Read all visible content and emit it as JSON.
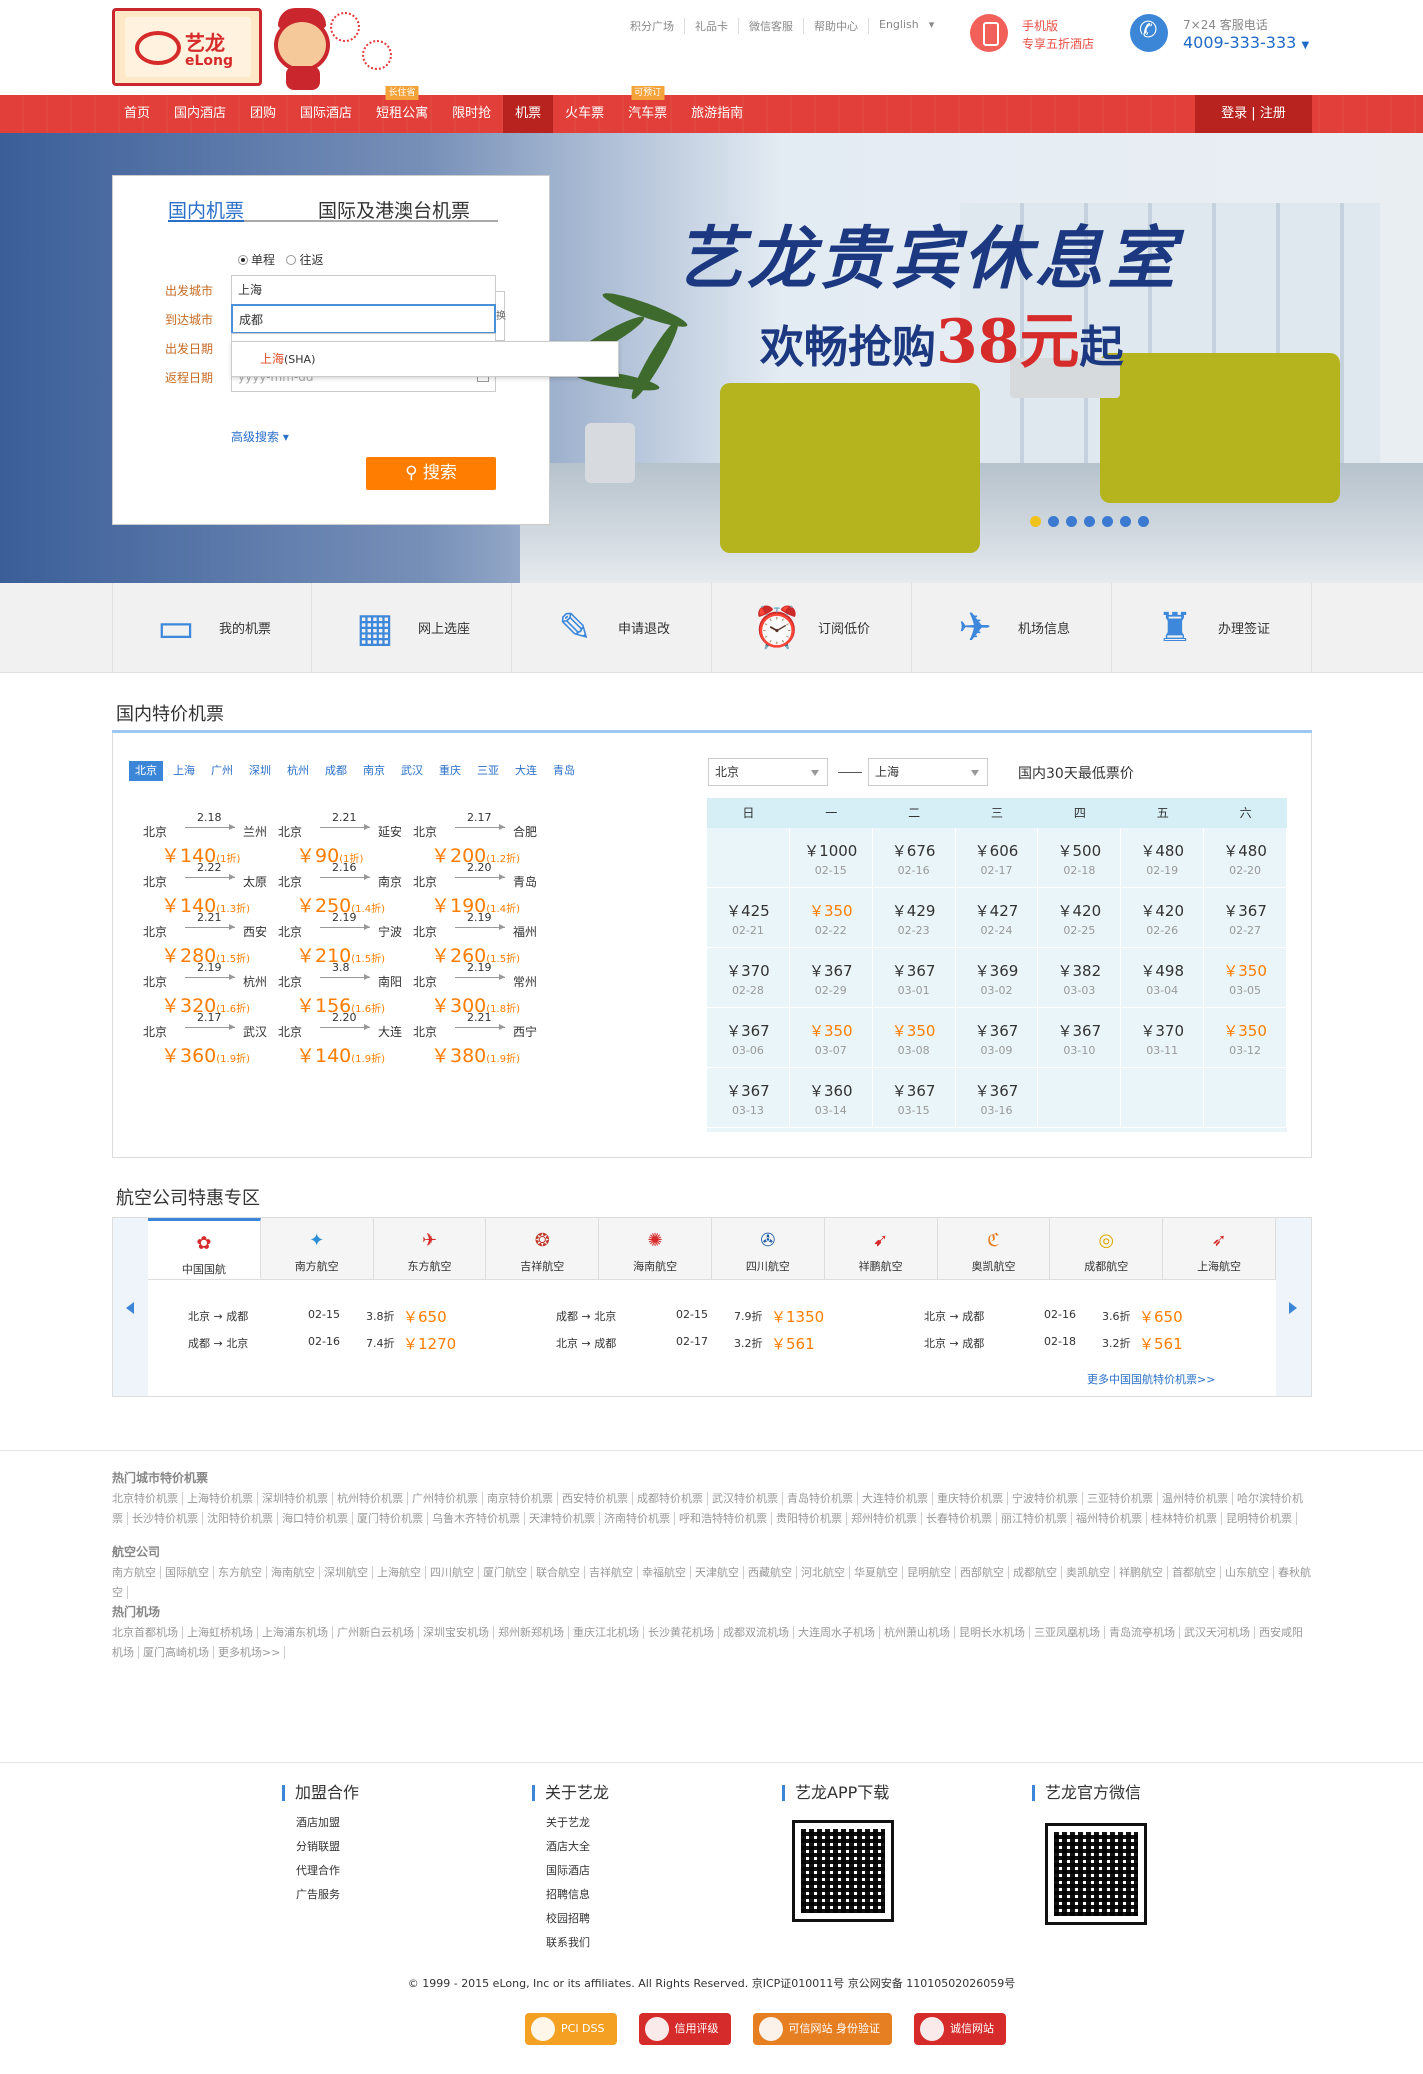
{
  "header": {
    "logo_cn": "艺龙",
    "logo_en": "eLong",
    "top_links": [
      "积分广场",
      "礼品卡",
      "微信客服",
      "帮助中心",
      "English"
    ],
    "mobile_title": "手机版",
    "mobile_sub": "专享五折酒店",
    "service_label": "7×24 客服电话",
    "service_phone": "4009-333-333"
  },
  "nav": {
    "items": [
      {
        "label": "首页",
        "badge": ""
      },
      {
        "label": "国内酒店",
        "badge": ""
      },
      {
        "label": "团购",
        "badge": ""
      },
      {
        "label": "国际酒店",
        "badge": ""
      },
      {
        "label": "短租公寓",
        "badge": "长住省"
      },
      {
        "label": "限时抢",
        "badge": ""
      },
      {
        "label": "机票",
        "badge": ""
      },
      {
        "label": "火车票",
        "badge": ""
      },
      {
        "label": "汽车票",
        "badge": "可预订"
      },
      {
        "label": "旅游指南",
        "badge": ""
      }
    ],
    "login": "登录 | 注册",
    "active_index": 6
  },
  "banner": {
    "title": "艺龙贵宾休息室",
    "sub_prefix": "欢畅抢购",
    "sub_price": "38元",
    "sub_suffix": "起",
    "slide_count": 7,
    "active_slide": 0
  },
  "search": {
    "tab_domestic": "国内机票",
    "tab_intl": "国际及港澳台机票",
    "one_way": "单程",
    "round_trip": "往返",
    "depart_label": "出发城市",
    "depart_value": "上海",
    "arrive_label": "到达城市",
    "arrive_value": "成都",
    "swap_label": "换",
    "date_label": "出发日期",
    "return_label": "返程日期",
    "return_placeholder": "yyyy-mm-dd",
    "suggestion_city": "上海",
    "suggestion_code": "(SHA)",
    "advanced": "高级搜索",
    "button": "搜索"
  },
  "quick_links": [
    {
      "label": "我的机票",
      "icon": "ticket-card-icon"
    },
    {
      "label": "网上选座",
      "icon": "seat-select-icon"
    },
    {
      "label": "申请退改",
      "icon": "edit-icon"
    },
    {
      "label": "订阅低价",
      "icon": "alarm-clock-icon"
    },
    {
      "label": "机场信息",
      "icon": "airplane-icon"
    },
    {
      "label": "办理签证",
      "icon": "stamp-icon"
    }
  ],
  "special": {
    "title": "国内特价机票",
    "cities": [
      "北京",
      "上海",
      "广州",
      "深圳",
      "杭州",
      "成都",
      "南京",
      "武汉",
      "重庆",
      "三亚",
      "大连",
      "青岛"
    ],
    "active_city": 0,
    "fares": [
      {
        "from": "北京",
        "to": "兰州",
        "date": "2.18",
        "price": "￥140",
        "disc": "(1折)"
      },
      {
        "from": "北京",
        "to": "延安",
        "date": "2.21",
        "price": "￥90",
        "disc": "(1折)"
      },
      {
        "from": "北京",
        "to": "合肥",
        "date": "2.17",
        "price": "￥200",
        "disc": "(1.2折)"
      },
      {
        "from": "北京",
        "to": "太原",
        "date": "2.22",
        "price": "￥140",
        "disc": "(1.3折)"
      },
      {
        "from": "北京",
        "to": "南京",
        "date": "2.16",
        "price": "￥250",
        "disc": "(1.4折)"
      },
      {
        "from": "北京",
        "to": "青岛",
        "date": "2.20",
        "price": "￥190",
        "disc": "(1.4折)"
      },
      {
        "from": "北京",
        "to": "西安",
        "date": "2.21",
        "price": "￥280",
        "disc": "(1.5折)"
      },
      {
        "from": "北京",
        "to": "宁波",
        "date": "2.19",
        "price": "￥210",
        "disc": "(1.5折)"
      },
      {
        "from": "北京",
        "to": "福州",
        "date": "2.19",
        "price": "￥260",
        "disc": "(1.5折)"
      },
      {
        "from": "北京",
        "to": "杭州",
        "date": "2.19",
        "price": "￥320",
        "disc": "(1.6折)"
      },
      {
        "from": "北京",
        "to": "南阳",
        "date": "3.8",
        "price": "￥156",
        "disc": "(1.6折)"
      },
      {
        "from": "北京",
        "to": "常州",
        "date": "2.19",
        "price": "￥300",
        "disc": "(1.8折)"
      },
      {
        "from": "北京",
        "to": "武汉",
        "date": "2.17",
        "price": "￥360",
        "disc": "(1.9折)"
      },
      {
        "from": "北京",
        "to": "大连",
        "date": "2.20",
        "price": "￥140",
        "disc": "(1.9折)"
      },
      {
        "from": "北京",
        "to": "西宁",
        "date": "2.21",
        "price": "￥380",
        "disc": "(1.9折)"
      }
    ],
    "from_select": "北京",
    "to_select": "上海",
    "calendar_label": "国内30天最低票价",
    "weekdays": [
      "日",
      "一",
      "二",
      "三",
      "四",
      "五",
      "六"
    ],
    "calendar": [
      {
        "col": 1,
        "row": 0,
        "price": "￥1000",
        "date": "02-15",
        "hi": false
      },
      {
        "col": 2,
        "row": 0,
        "price": "￥676",
        "date": "02-16",
        "hi": false
      },
      {
        "col": 3,
        "row": 0,
        "price": "￥606",
        "date": "02-17",
        "hi": false
      },
      {
        "col": 4,
        "row": 0,
        "price": "￥500",
        "date": "02-18",
        "hi": false
      },
      {
        "col": 5,
        "row": 0,
        "price": "￥480",
        "date": "02-19",
        "hi": false
      },
      {
        "col": 6,
        "row": 0,
        "price": "￥480",
        "date": "02-20",
        "hi": false
      },
      {
        "col": 0,
        "row": 1,
        "price": "￥425",
        "date": "02-21",
        "hi": false
      },
      {
        "col": 1,
        "row": 1,
        "price": "￥350",
        "date": "02-22",
        "hi": true
      },
      {
        "col": 2,
        "row": 1,
        "price": "￥429",
        "date": "02-23",
        "hi": false
      },
      {
        "col": 3,
        "row": 1,
        "price": "￥427",
        "date": "02-24",
        "hi": false
      },
      {
        "col": 4,
        "row": 1,
        "price": "￥420",
        "date": "02-25",
        "hi": false
      },
      {
        "col": 5,
        "row": 1,
        "price": "￥420",
        "date": "02-26",
        "hi": false
      },
      {
        "col": 6,
        "row": 1,
        "price": "￥367",
        "date": "02-27",
        "hi": false
      },
      {
        "col": 0,
        "row": 2,
        "price": "￥370",
        "date": "02-28",
        "hi": false
      },
      {
        "col": 1,
        "row": 2,
        "price": "￥367",
        "date": "02-29",
        "hi": false
      },
      {
        "col": 2,
        "row": 2,
        "price": "￥367",
        "date": "03-01",
        "hi": false
      },
      {
        "col": 3,
        "row": 2,
        "price": "￥369",
        "date": "03-02",
        "hi": false
      },
      {
        "col": 4,
        "row": 2,
        "price": "￥382",
        "date": "03-03",
        "hi": false
      },
      {
        "col": 5,
        "row": 2,
        "price": "￥498",
        "date": "03-04",
        "hi": false
      },
      {
        "col": 6,
        "row": 2,
        "price": "￥350",
        "date": "03-05",
        "hi": true
      },
      {
        "col": 0,
        "row": 3,
        "price": "￥367",
        "date": "03-06",
        "hi": false
      },
      {
        "col": 1,
        "row": 3,
        "price": "￥350",
        "date": "03-07",
        "hi": true
      },
      {
        "col": 2,
        "row": 3,
        "price": "￥350",
        "date": "03-08",
        "hi": true
      },
      {
        "col": 3,
        "row": 3,
        "price": "￥367",
        "date": "03-09",
        "hi": false
      },
      {
        "col": 4,
        "row": 3,
        "price": "￥367",
        "date": "03-10",
        "hi": false
      },
      {
        "col": 5,
        "row": 3,
        "price": "￥370",
        "date": "03-11",
        "hi": false
      },
      {
        "col": 6,
        "row": 3,
        "price": "￥350",
        "date": "03-12",
        "hi": true
      },
      {
        "col": 0,
        "row": 4,
        "price": "￥367",
        "date": "03-13",
        "hi": false
      },
      {
        "col": 1,
        "row": 4,
        "price": "￥360",
        "date": "03-14",
        "hi": false
      },
      {
        "col": 2,
        "row": 4,
        "price": "￥367",
        "date": "03-15",
        "hi": false
      },
      {
        "col": 3,
        "row": 4,
        "price": "￥367",
        "date": "03-16",
        "hi": false
      }
    ]
  },
  "airlines": {
    "title": "航空公司特惠专区",
    "tabs": [
      {
        "name": "中国国航",
        "color": "#d62b2b"
      },
      {
        "name": "南方航空",
        "color": "#2a8fd4"
      },
      {
        "name": "东方航空",
        "color": "#d62b2b"
      },
      {
        "name": "吉祥航空",
        "color": "#c0392b"
      },
      {
        "name": "海南航空",
        "color": "#d62b2b"
      },
      {
        "name": "四川航空",
        "color": "#1f5ea8"
      },
      {
        "name": "祥鹏航空",
        "color": "#d62b2b"
      },
      {
        "name": "奥凯航空",
        "color": "#e67e22"
      },
      {
        "name": "成都航空",
        "color": "#e0a800"
      },
      {
        "name": "上海航空",
        "color": "#d62b2b"
      }
    ],
    "active_tab": 0,
    "routes": [
      {
        "route": "北京 → 成都",
        "date": "02-15",
        "disc": "3.8折",
        "price": "￥650"
      },
      {
        "route": "成都 → 北京",
        "date": "02-15",
        "disc": "7.9折",
        "price": "￥1350"
      },
      {
        "route": "北京 → 成都",
        "date": "02-16",
        "disc": "3.6折",
        "price": "￥650"
      },
      {
        "route": "成都 → 北京",
        "date": "02-16",
        "disc": "7.4折",
        "price": "￥1270"
      },
      {
        "route": "北京 → 成都",
        "date": "02-17",
        "disc": "3.2折",
        "price": "￥561"
      },
      {
        "route": "北京 → 成都",
        "date": "02-18",
        "disc": "3.2折",
        "price": "￥561"
      }
    ],
    "more": "更多中国国航特价机票>>"
  },
  "link_groups": [
    {
      "title": "热门城市特价机票",
      "links": [
        "北京特价机票",
        "上海特价机票",
        "深圳特价机票",
        "杭州特价机票",
        "广州特价机票",
        "南京特价机票",
        "西安特价机票",
        "成都特价机票",
        "武汉特价机票",
        "青岛特价机票",
        "大连特价机票",
        "重庆特价机票",
        "宁波特价机票",
        "三亚特价机票",
        "温州特价机票",
        "哈尔滨特价机票",
        "长沙特价机票",
        "沈阳特价机票",
        "海口特价机票",
        "厦门特价机票",
        "乌鲁木齐特价机票",
        "天津特价机票",
        "济南特价机票",
        "呼和浩特特价机票",
        "贵阳特价机票",
        "郑州特价机票",
        "长春特价机票",
        "丽江特价机票",
        "福州特价机票",
        "桂林特价机票",
        "昆明特价机票"
      ]
    },
    {
      "title": "航空公司",
      "links": [
        "南方航空",
        "国际航空",
        "东方航空",
        "海南航空",
        "深圳航空",
        "上海航空",
        "四川航空",
        "厦门航空",
        "联合航空",
        "吉祥航空",
        "幸福航空",
        "天津航空",
        "西藏航空",
        "河北航空",
        "华夏航空",
        "昆明航空",
        "西部航空",
        "成都航空",
        "奥凯航空",
        "祥鹏航空",
        "首都航空",
        "山东航空",
        "春秋航空"
      ]
    },
    {
      "title": "热门机场",
      "links": [
        "北京首都机场",
        "上海虹桥机场",
        "上海浦东机场",
        "广州新白云机场",
        "深圳宝安机场",
        "郑州新郑机场",
        "重庆江北机场",
        "长沙黄花机场",
        "成都双流机场",
        "大连周水子机场",
        "杭州萧山机场",
        "昆明长水机场",
        "三亚凤凰机场",
        "青岛流亭机场",
        "武汉天河机场",
        "西安咸阳机场",
        "厦门高崎机场",
        "更多机场>>"
      ]
    }
  ],
  "footer": {
    "cols": [
      {
        "title": "加盟合作",
        "links": [
          "酒店加盟",
          "分销联盟",
          "代理合作",
          "广告服务"
        ]
      },
      {
        "title": "关于艺龙",
        "links": [
          "关于艺龙",
          "酒店大全",
          "国际酒店",
          "招聘信息",
          "校园招聘",
          "联系我们"
        ]
      },
      {
        "title": "艺龙APP下载",
        "links": []
      },
      {
        "title": "艺龙官方微信",
        "links": []
      }
    ],
    "copyright": "© 1999 - 2015 eLong, Inc or its affiliates. All Rights Reserved. 京ICP证010011号 京公网安备 110105020260​59号",
    "badges": [
      {
        "label": "PCI DSS",
        "color": "#f4a023"
      },
      {
        "label": "信用评级",
        "color": "#d62b2b"
      },
      {
        "label": "可信网站 身份验证",
        "color": "#e67e22"
      },
      {
        "label": "诚信网站",
        "color": "#d62b2b"
      }
    ]
  }
}
